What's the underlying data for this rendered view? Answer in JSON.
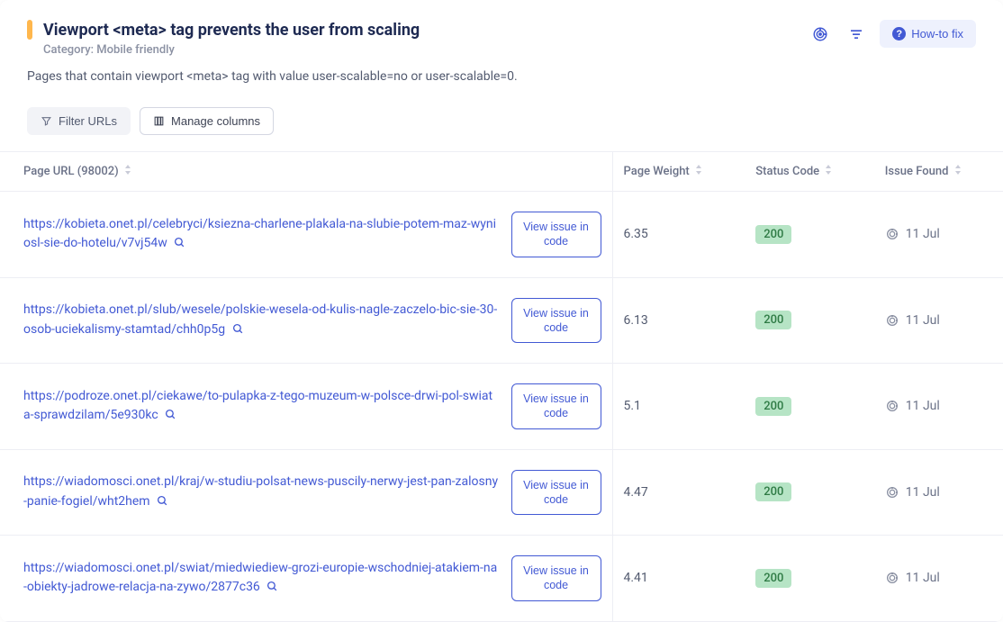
{
  "header": {
    "title": "Viewport <meta> tag prevents the user from scaling",
    "category": "Category: Mobile friendly",
    "description": "Pages that contain viewport <meta> tag with value user-scalable=no or user-scalable=0.",
    "howto_label": "How-to fix"
  },
  "toolbar": {
    "filter_label": "Filter URLs",
    "manage_label": "Manage columns"
  },
  "columns": {
    "url": "Page URL (98002)",
    "weight": "Page Weight",
    "status": "Status Code",
    "issue": "Issue Found"
  },
  "view_issue_label": "View issue in code",
  "rows": [
    {
      "url": "https://kobieta.onet.pl/celebryci/ksiezna-charlene-plakala-na-slubie-potem-maz-wyniosl-sie-do-hotelu/v7vj54w",
      "weight": "6.35",
      "status": "200",
      "issue": "11 Jul"
    },
    {
      "url": "https://kobieta.onet.pl/slub/wesele/polskie-wesela-od-kulis-nagle-zaczelo-bic-sie-30-osob-uciekalismy-stamtad/chh0p5g",
      "weight": "6.13",
      "status": "200",
      "issue": "11 Jul"
    },
    {
      "url": "https://podroze.onet.pl/ciekawe/to-pulapka-z-tego-muzeum-w-polsce-drwi-pol-swiata-sprawdzilam/5e930kc",
      "weight": "5.1",
      "status": "200",
      "issue": "11 Jul"
    },
    {
      "url": "https://wiadomosci.onet.pl/kraj/w-studiu-polsat-news-puscily-nerwy-jest-pan-zalosny-panie-fogiel/wht2hem",
      "weight": "4.47",
      "status": "200",
      "issue": "11 Jul"
    },
    {
      "url": "https://wiadomosci.onet.pl/swiat/miedwiediew-grozi-europie-wschodniej-atakiem-na-obiekty-jadrowe-relacja-na-zywo/2877c36",
      "weight": "4.41",
      "status": "200",
      "issue": "11 Jul"
    }
  ]
}
